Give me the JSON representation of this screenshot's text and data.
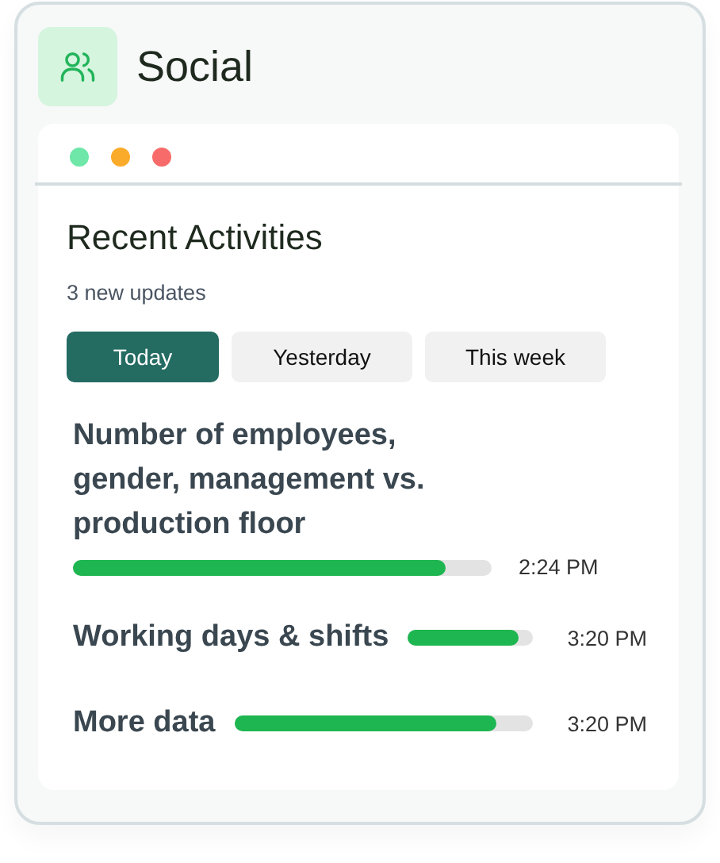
{
  "header": {
    "title": "Social"
  },
  "window_dots": [
    {
      "color": "#6ee7a8"
    },
    {
      "color": "#fbab2a"
    },
    {
      "color": "#f76c6a"
    }
  ],
  "panel": {
    "title": "Recent Activities",
    "subtitle": "3 new updates"
  },
  "tabs": [
    {
      "label": "Today",
      "selected": true
    },
    {
      "label": "Yesterday",
      "selected": false
    },
    {
      "label": "This week",
      "selected": false
    }
  ],
  "activities": [
    {
      "kind": "stacked",
      "title": "Number of employees, gender, management vs. production floor",
      "level": 0.89,
      "time": "2:24 PM"
    },
    {
      "kind": "inline",
      "title": "Working days & shifts",
      "level": 0.89,
      "time": "3:20 PM"
    },
    {
      "kind": "inline",
      "title": "More data",
      "level": 0.88,
      "time": "3:20 PM"
    }
  ]
}
